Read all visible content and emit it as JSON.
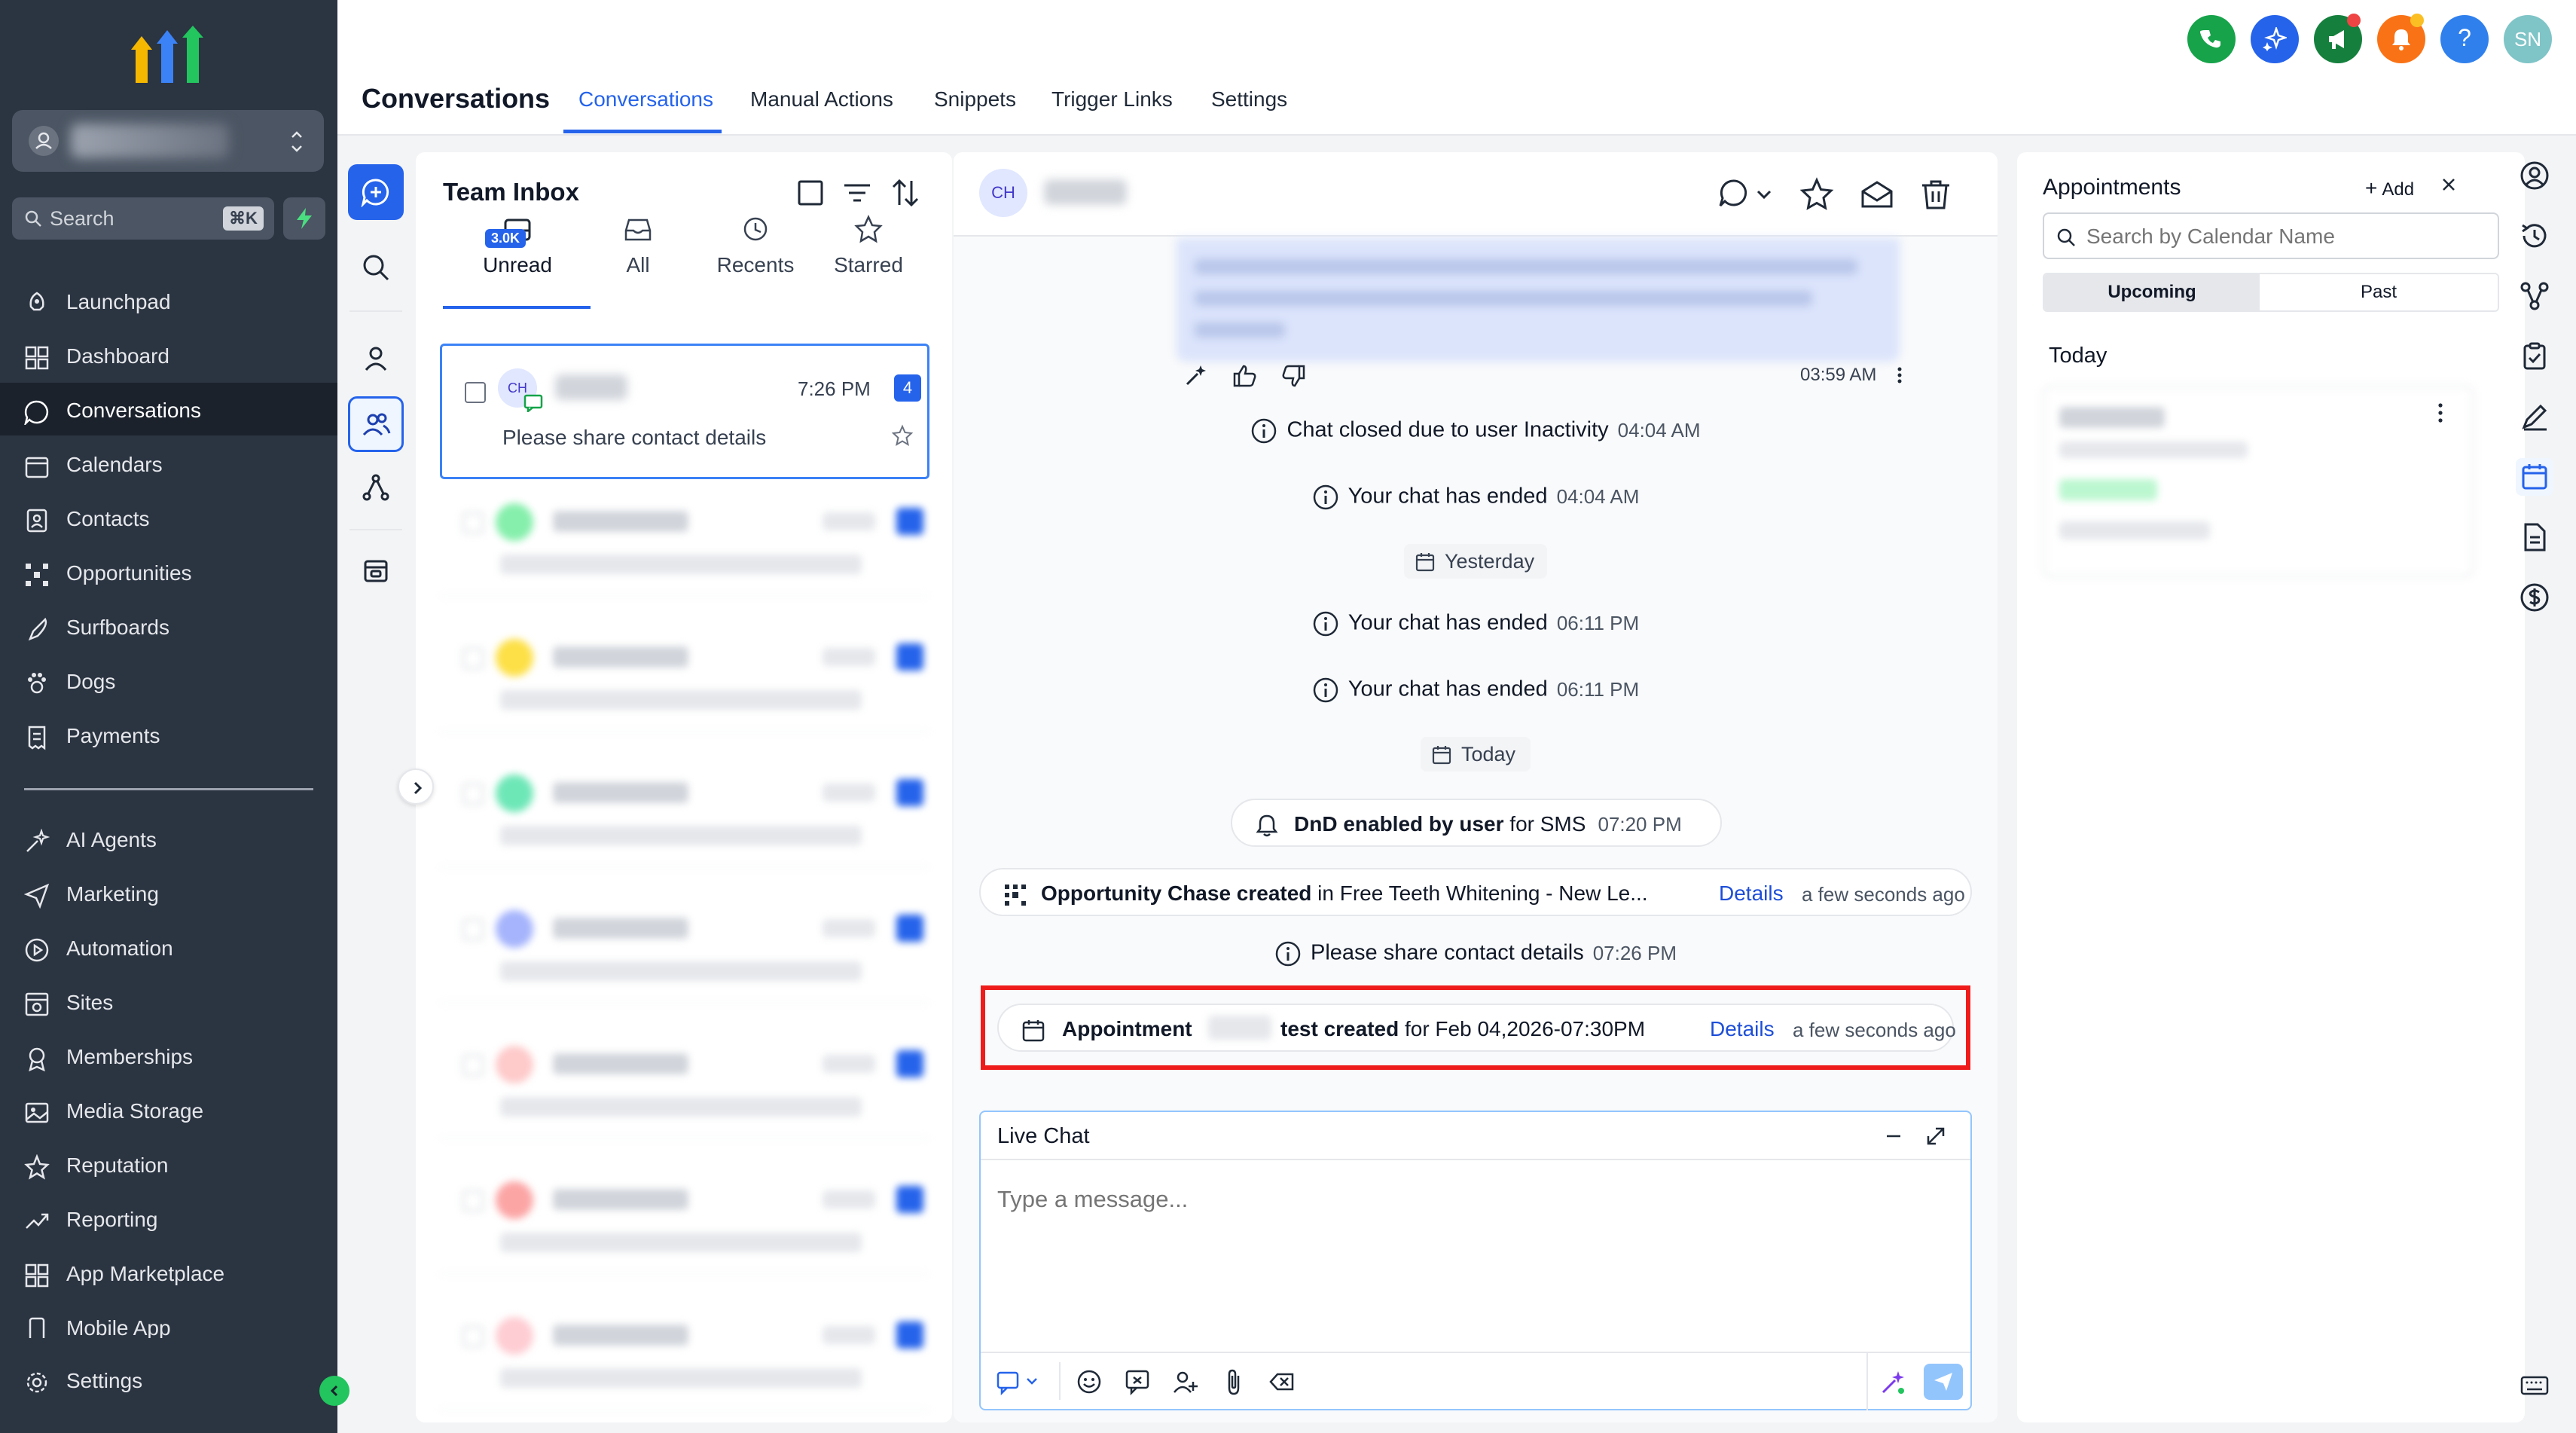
{
  "colors": {
    "brand_blue": "#2563eb",
    "nav_bg": "#2b3441",
    "highlight_red": "#ef1c1c",
    "green": "#22c55e"
  },
  "sidebar": {
    "search_placeholder": "Search",
    "search_shortcut": "⌘K",
    "items": [
      {
        "label": "Launchpad",
        "icon": "rocket-icon"
      },
      {
        "label": "Dashboard",
        "icon": "grid-icon"
      },
      {
        "label": "Conversations",
        "icon": "chat-bubble-icon",
        "active": true
      },
      {
        "label": "Calendars",
        "icon": "calendar-icon"
      },
      {
        "label": "Contacts",
        "icon": "contacts-icon"
      },
      {
        "label": "Opportunities",
        "icon": "opportunities-icon"
      },
      {
        "label": "Surfboards",
        "icon": "surfboard-icon"
      },
      {
        "label": "Dogs",
        "icon": "paw-icon"
      },
      {
        "label": "Payments",
        "icon": "receipt-icon"
      }
    ],
    "items2": [
      {
        "label": "AI Agents",
        "icon": "sparkle-icon"
      },
      {
        "label": "Marketing",
        "icon": "send-icon"
      },
      {
        "label": "Automation",
        "icon": "play-circle-icon"
      },
      {
        "label": "Sites",
        "icon": "sites-icon"
      },
      {
        "label": "Memberships",
        "icon": "award-icon"
      },
      {
        "label": "Media Storage",
        "icon": "image-icon"
      },
      {
        "label": "Reputation",
        "icon": "star-icon"
      },
      {
        "label": "Reporting",
        "icon": "trend-icon"
      },
      {
        "label": "App Marketplace",
        "icon": "apps-icon"
      },
      {
        "label": "Mobile App",
        "icon": "mobile-icon"
      }
    ],
    "settings_label": "Settings"
  },
  "header": {
    "title": "Conversations",
    "tabs": [
      "Conversations",
      "Manual Actions",
      "Snippets",
      "Trigger Links",
      "Settings"
    ],
    "avatar_initials": "SN",
    "help_label": "?"
  },
  "inbox": {
    "title": "Team Inbox",
    "unread_badge": "3.0K",
    "tabs": [
      "Unread",
      "All",
      "Recents",
      "Starred"
    ],
    "selected_conversation": {
      "initials": "CH",
      "time": "7:26 PM",
      "count": "4",
      "preview": "Please share contact details"
    }
  },
  "chat": {
    "contact_initials": "CH",
    "message_time": "03:59 AM",
    "events": {
      "closed_inactivity": "Chat closed due to user Inactivity",
      "closed_inactivity_time": "04:04 AM",
      "ended_1": "Your chat has ended",
      "ended_1_time": "04:04 AM",
      "yesterday": "Yesterday",
      "ended_2": "Your chat has ended",
      "ended_2_time": "06:11 PM",
      "ended_3": "Your chat has ended",
      "ended_3_time": "06:11 PM",
      "today": "Today",
      "dnd_bold": "DnD enabled by user",
      "dnd_rest": " for SMS",
      "dnd_time": "07:20 PM",
      "opp_bold": "Opportunity Chase created",
      "opp_rest": " in Free Teeth Whitening - New Le...",
      "opp_link": "Details",
      "opp_ago": "a few seconds ago",
      "share_text": "Please share contact details",
      "share_time": "07:26 PM",
      "appt_bold1": "Appointment",
      "appt_bold2": "test created",
      "appt_rest": " for Feb 04,2026-07:30PM",
      "appt_link": "Details",
      "appt_ago": "a few seconds ago"
    },
    "composer": {
      "channel": "Live Chat",
      "placeholder": "Type a message..."
    }
  },
  "appointments": {
    "title": "Appointments",
    "add_label": "Add",
    "search_placeholder": "Search by Calendar Name",
    "segments": [
      "Upcoming",
      "Past"
    ],
    "today_label": "Today"
  }
}
